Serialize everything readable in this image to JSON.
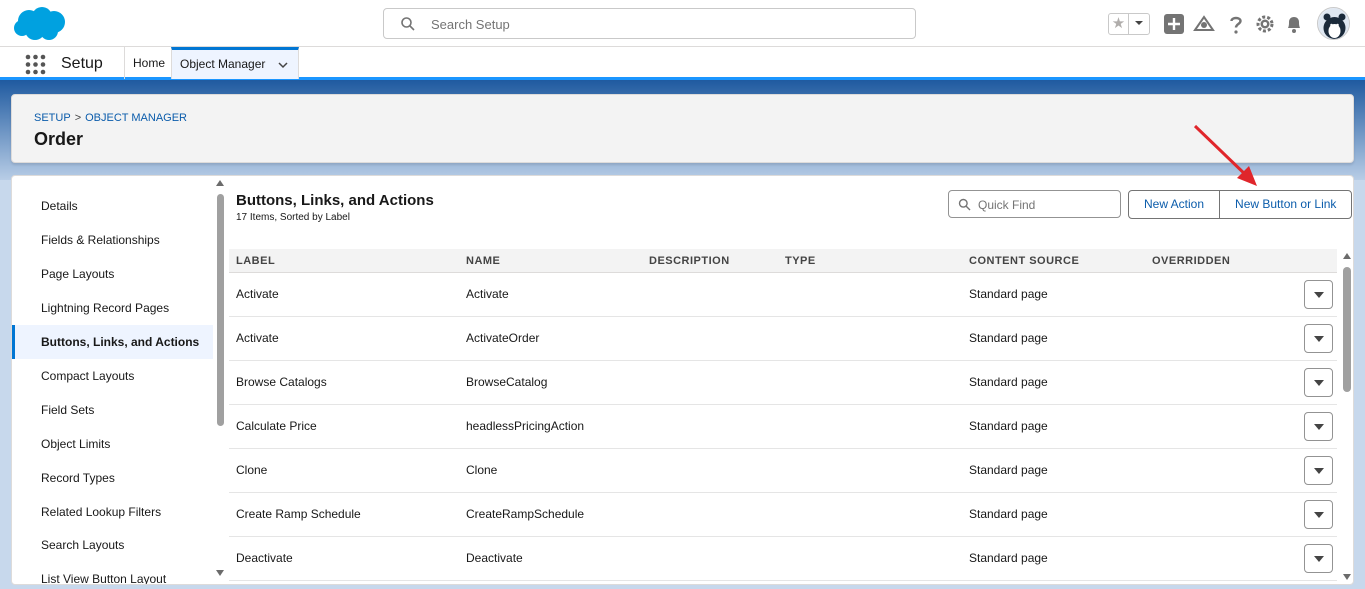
{
  "header": {
    "search_placeholder": "Search Setup",
    "icons": [
      "favorites-star-icon",
      "favorites-dropdown-icon",
      "add-icon",
      "trailhead-icon",
      "help-icon",
      "settings-gear-icon",
      "notifications-bell-icon",
      "user-avatar"
    ]
  },
  "nav": {
    "app_name": "Setup",
    "tabs": [
      {
        "label": "Home"
      },
      {
        "label": "Object Manager"
      }
    ]
  },
  "page": {
    "breadcrumb": [
      "SETUP",
      "OBJECT MANAGER"
    ],
    "breadcrumb_separator": ">",
    "title": "Order"
  },
  "sidebar": {
    "items": [
      {
        "label": "Details"
      },
      {
        "label": "Fields & Relationships"
      },
      {
        "label": "Page Layouts"
      },
      {
        "label": "Lightning Record Pages"
      },
      {
        "label": "Buttons, Links, and Actions",
        "active": true
      },
      {
        "label": "Compact Layouts"
      },
      {
        "label": "Field Sets"
      },
      {
        "label": "Object Limits"
      },
      {
        "label": "Record Types"
      },
      {
        "label": "Related Lookup Filters"
      },
      {
        "label": "Search Layouts"
      },
      {
        "label": "List View Button Layout"
      }
    ]
  },
  "content": {
    "title": "Buttons, Links, and Actions",
    "subtitle": "17 Items, Sorted by Label",
    "quick_find_placeholder": "Quick Find",
    "buttons": {
      "new_action": "New Action",
      "new_button_or_link": "New Button or Link"
    },
    "columns": [
      "LABEL",
      "NAME",
      "DESCRIPTION",
      "TYPE",
      "CONTENT SOURCE",
      "OVERRIDDEN"
    ],
    "rows": [
      {
        "label": "Activate",
        "name": "Activate",
        "description": "",
        "type": "",
        "content_source": "Standard page",
        "overridden": ""
      },
      {
        "label": "Activate",
        "name": "ActivateOrder",
        "description": "",
        "type": "",
        "content_source": "Standard page",
        "overridden": ""
      },
      {
        "label": "Browse Catalogs",
        "name": "BrowseCatalog",
        "description": "",
        "type": "",
        "content_source": "Standard page",
        "overridden": ""
      },
      {
        "label": "Calculate Price",
        "name": "headlessPricingAction",
        "description": "",
        "type": "",
        "content_source": "Standard page",
        "overridden": ""
      },
      {
        "label": "Clone",
        "name": "Clone",
        "description": "",
        "type": "",
        "content_source": "Standard page",
        "overridden": ""
      },
      {
        "label": "Create Ramp Schedule",
        "name": "CreateRampSchedule",
        "description": "",
        "type": "",
        "content_source": "Standard page",
        "overridden": ""
      },
      {
        "label": "Deactivate",
        "name": "Deactivate",
        "description": "",
        "type": "",
        "content_source": "Standard page",
        "overridden": ""
      }
    ]
  },
  "colors": {
    "brand_blue": "#0176d3",
    "link_blue": "#0b5cab",
    "annotation_arrow": "#e0262b"
  }
}
